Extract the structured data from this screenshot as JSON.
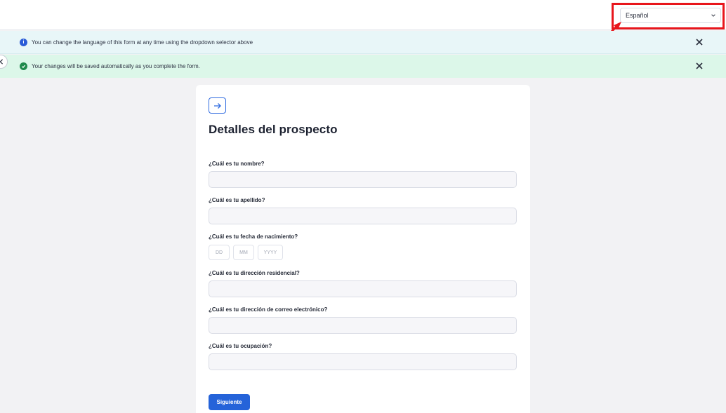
{
  "topbar": {
    "language_select": {
      "value": "Español",
      "icon": "chevron-down-icon"
    }
  },
  "banners": {
    "info": {
      "text": "You can change the language of this form at any time using the dropdown selector above",
      "icon": "info-icon"
    },
    "success": {
      "text": "Your changes will be saved automatically as you complete the form.",
      "icon": "check-circle-icon"
    }
  },
  "form": {
    "icon": "arrow-right-icon",
    "title": "Detalles del prospecto",
    "questions": [
      {
        "label": "¿Cuál es tu nombre?",
        "value": ""
      },
      {
        "label": "¿Cuál es tu apellido?",
        "value": ""
      },
      {
        "label": "¿Cuál es tu fecha de nacimiento?",
        "value": ""
      },
      {
        "label": "¿Cuál es tu dirección residencial?",
        "value": ""
      },
      {
        "label": "¿Cuál es tu dirección de correo electrónico?",
        "value": ""
      },
      {
        "label": "¿Cuál es tu ocupación?",
        "value": ""
      }
    ],
    "date_placeholders": {
      "day": "DD",
      "month": "MM",
      "year": "YYYY"
    },
    "next_label": "Siguiente"
  },
  "colors": {
    "accent": "#2563d9",
    "highlight": "#e8161c",
    "info_bg": "#e8f6f8",
    "success_bg": "#dcf7e9"
  }
}
